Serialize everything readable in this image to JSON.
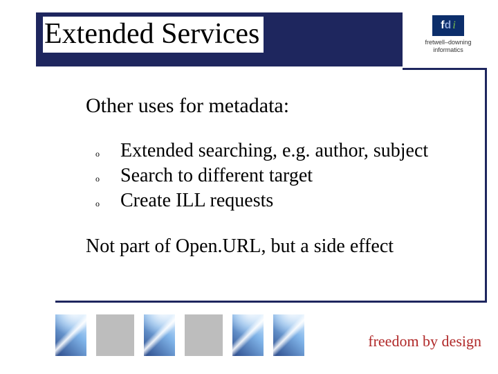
{
  "title": "Extended Services",
  "logo": {
    "letters_f": "f",
    "letters_d": "d",
    "letters_i": "i",
    "line1": "fretwell–downing",
    "line2": "informatics"
  },
  "heading": "Other uses for metadata:",
  "bullets": [
    "Extended searching, e.g. author, subject",
    "Search to different target",
    "Create ILL requests"
  ],
  "footnote": "Not part of Open.URL, but a side effect",
  "tagline": "freedom by design",
  "bullet_marker": "o"
}
